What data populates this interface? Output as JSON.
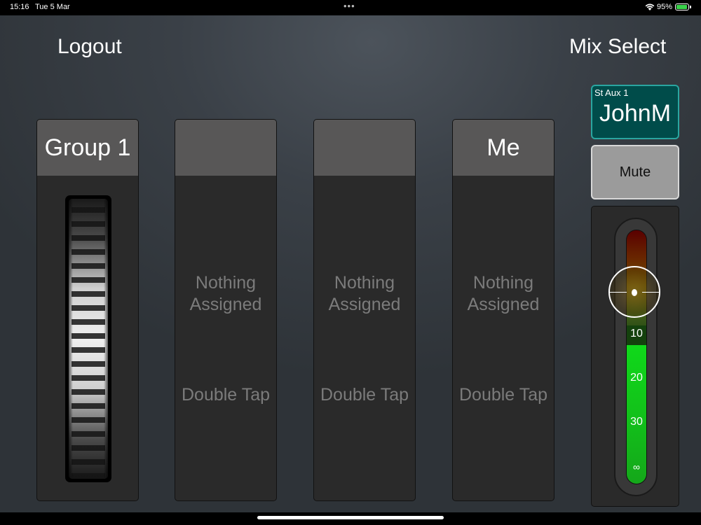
{
  "status_bar": {
    "time": "15:16",
    "date": "Tue 5 Mar",
    "dots": "•••",
    "battery_percent": "95%",
    "battery_level": 0.95,
    "battery_color": "#39d24a"
  },
  "header": {
    "logout_label": "Logout",
    "mix_select_label": "Mix Select"
  },
  "strips": [
    {
      "title": "Group 1",
      "has_encoder": true
    },
    {
      "title": "",
      "nothing_line1": "Nothing",
      "nothing_line2": "Assigned",
      "double_tap": "Double Tap"
    },
    {
      "title": "",
      "nothing_line1": "Nothing",
      "nothing_line2": "Assigned",
      "double_tap": "Double Tap"
    },
    {
      "title": "Me",
      "nothing_line1": "Nothing",
      "nothing_line2": "Assigned",
      "double_tap": "Double Tap"
    }
  ],
  "mix": {
    "subtitle": "St Aux 1",
    "name": "JohnM",
    "accent": "#004c4a"
  },
  "mute": {
    "label": "Mute"
  },
  "fader": {
    "scale": [
      "10",
      "20",
      "30",
      "∞"
    ],
    "level_fraction": 0.75,
    "meter_green_fraction": 0.55,
    "meter_color": "#12c21a"
  },
  "icons": {
    "wifi": "wifi-icon",
    "battery": "battery-charging-icon"
  }
}
